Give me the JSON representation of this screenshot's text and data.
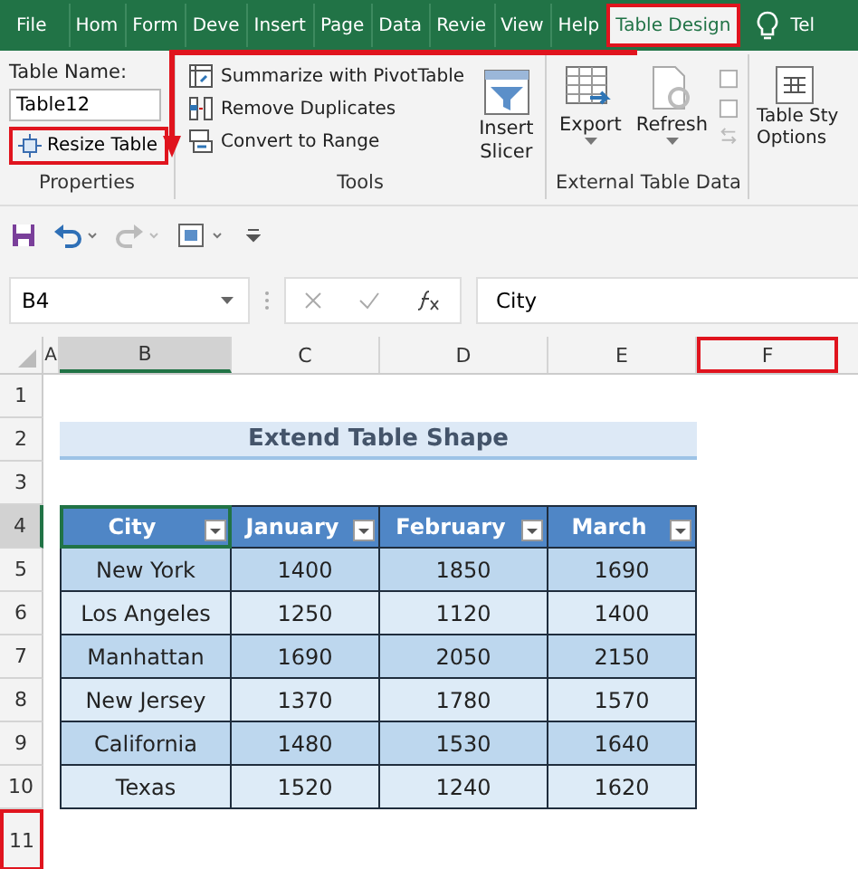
{
  "ribbon_tabs": [
    {
      "label": "File",
      "selected": false,
      "highlighted": false
    },
    {
      "label": "Hom",
      "selected": false,
      "highlighted": false
    },
    {
      "label": "Form",
      "selected": false,
      "highlighted": false
    },
    {
      "label": "Deve",
      "selected": false,
      "highlighted": false
    },
    {
      "label": "Insert",
      "selected": false,
      "highlighted": false
    },
    {
      "label": "Page",
      "selected": false,
      "highlighted": false
    },
    {
      "label": "Data",
      "selected": false,
      "highlighted": false
    },
    {
      "label": "Revie",
      "selected": false,
      "highlighted": false
    },
    {
      "label": "View",
      "selected": false,
      "highlighted": false
    },
    {
      "label": "Help",
      "selected": false,
      "highlighted": false
    },
    {
      "label": "Table Design",
      "selected": true,
      "highlighted": true
    }
  ],
  "tell_me": "Tel",
  "properties": {
    "name_label": "Table Name:",
    "name_value": "Table12",
    "resize_button": {
      "label": "Resize Table",
      "highlighted": true
    },
    "group_label": "Properties"
  },
  "tools": {
    "commands": [
      "Summarize with PivotTable",
      "Remove Duplicates",
      "Convert to Range"
    ],
    "slicer_lines": [
      "Insert",
      "Slicer"
    ],
    "group_label": "Tools"
  },
  "external": {
    "buttons": [
      "Export",
      "Refresh"
    ],
    "group_label": "External Table Data"
  },
  "style_options_lines": [
    "Table Sty",
    "Options"
  ],
  "formula_bar": {
    "name_box": "B4",
    "formula": "City"
  },
  "columns": [
    {
      "label": "A",
      "selected": false,
      "highlighted": false
    },
    {
      "label": "B",
      "selected": true,
      "highlighted": false
    },
    {
      "label": "C",
      "selected": false,
      "highlighted": false
    },
    {
      "label": "D",
      "selected": false,
      "highlighted": false
    },
    {
      "label": "E",
      "selected": false,
      "highlighted": false
    },
    {
      "label": "F",
      "selected": false,
      "highlighted": true
    }
  ],
  "rows": [
    {
      "label": "1",
      "selected": false,
      "highlighted": false
    },
    {
      "label": "2",
      "selected": false,
      "highlighted": false
    },
    {
      "label": "3",
      "selected": false,
      "highlighted": false
    },
    {
      "label": "4",
      "selected": true,
      "highlighted": false
    },
    {
      "label": "5",
      "selected": false,
      "highlighted": false
    },
    {
      "label": "6",
      "selected": false,
      "highlighted": false
    },
    {
      "label": "7",
      "selected": false,
      "highlighted": false
    },
    {
      "label": "8",
      "selected": false,
      "highlighted": false
    },
    {
      "label": "9",
      "selected": false,
      "highlighted": false
    },
    {
      "label": "10",
      "selected": false,
      "highlighted": false
    },
    {
      "label": "11",
      "selected": false,
      "highlighted": true
    }
  ],
  "sheet_title": "Extend Table Shape",
  "table": {
    "columns": [
      "City",
      "January",
      "February",
      "March"
    ],
    "rows": [
      [
        "New York",
        "1400",
        "1850",
        "1690"
      ],
      [
        "Los Angeles",
        "1250",
        "1120",
        "1400"
      ],
      [
        "Manhattan",
        "1690",
        "2050",
        "2150"
      ],
      [
        "New Jersey",
        "1370",
        "1780",
        "1570"
      ],
      [
        "California",
        "1480",
        "1530",
        "1640"
      ],
      [
        "Texas",
        "1520",
        "1240",
        "1620"
      ]
    ]
  }
}
